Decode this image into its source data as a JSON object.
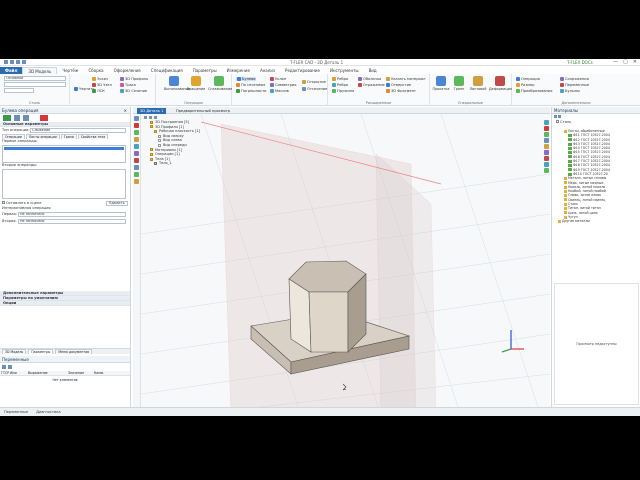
{
  "window": {
    "title": "T-FLEX CAD - 3D Деталь 1",
    "account": "T-FLEX DOCs",
    "minimize": "—",
    "maximize": "▢",
    "close": "✕"
  },
  "menu": [
    "Файл",
    "3D Модель",
    "Чертёж",
    "Сборка",
    "Оформление",
    "Спецификация",
    "Параметры",
    "Измерение",
    "Анализ",
    "Редактирование",
    "Инструменты",
    "Вид"
  ],
  "ribbon": {
    "document": {
      "combo1": "Основной",
      "combo2": "",
      "label": "Стиль"
    },
    "sketch": {
      "items": [
        "Чертить",
        "Эскиз",
        "3D Узел",
        "ЛСК",
        "3D Профиль",
        "Траса",
        "3D Сечение"
      ],
      "label": ""
    },
    "operations": {
      "items": [
        "Выталкивание",
        "Вращение",
        "Сглаживание"
      ],
      "label": "Операции"
    },
    "booleans": {
      "items": [
        "Булева",
        "По сечениям",
        "Погрешности",
        "Уклон",
        "Симметрия",
        "Массив",
        "Открытие",
        "Отсечение"
      ],
      "label": ""
    },
    "extended": {
      "items": [
        "Ребра",
        "Ребро",
        "Пружина",
        "Оболочка",
        "Отражение",
        "Указать материал",
        "Отверстие",
        "3D Фрагмент"
      ],
      "label": "Расширенные"
    },
    "special": {
      "items": [
        "Прокатка",
        "Гранн",
        "Листовой",
        "Деформация"
      ],
      "label": "Специальные"
    },
    "extra": {
      "items": [
        "Операция",
        "Размер",
        "Преобразования",
        "Сопряжения",
        "Переменные",
        "Булыны"
      ],
      "label": "Дополнительно"
    }
  },
  "left_panel": {
    "title": "Булева операция",
    "sections": {
      "main_params": "Основные параметры",
      "extra_params": "Дополнительные параметры",
      "default_params": "Параметры по умолчанию",
      "options": "Опции"
    },
    "op_type_label": "Тип операции:",
    "op_type_value": "Сложение",
    "subtabs": [
      "Операции",
      "Листы операции",
      "Грани",
      "Свойства тела"
    ],
    "first_ops_label": "Первые операнды:",
    "second_ops_label": "Вторые операнды:",
    "leave_checkbox": "Оставлять в сцене",
    "delete_btn": "Удалить",
    "intersect_label": "Интерактивная операция",
    "first_label": "Первая:",
    "first_value": "Не назначено",
    "second_label": "Вторая:",
    "second_value": "Не назначено",
    "bottom_tabs": [
      "3D Модель",
      "Параметры",
      "Меню документов"
    ],
    "vars": {
      "title": "Переменные",
      "columns": [
        "ГТСР",
        "Имя",
        "Выражение",
        "Значение",
        "Комм."
      ],
      "empty": "Нет элементов"
    }
  },
  "doc_tabs": [
    "3D Деталь 1",
    "Предварительный просмотр"
  ],
  "model_tree": {
    "nodes": [
      "3D Построения [5]",
      "3D Профили [1]",
      "Рабочая плоскость [1]",
      "Вид сверху",
      "Вид слева",
      "Вид спереди",
      "Материалы [1]",
      "Операции [1]",
      "Тела [1]",
      "Тело_1"
    ]
  },
  "right_panel": {
    "title": "Материалы",
    "filter": "Сталь",
    "items": [
      "Листы, обработанные",
      "Ф11 ГОСТ 10527-2004",
      "Ф12 ГОСТ 10527-2004",
      "Ф13 ГОСТ 10527-2004",
      "Ф14 ГОСТ 10527-2004",
      "Ф15 ГОСТ 10527-2004",
      "Ф16 ГОСТ 10527-2004",
      "Ф17 ГОСТ 10527-2004",
      "Ф18 ГОСТ 10527-2004",
      "Ф19 ГОСТ 10527-2004",
      "Ф110 ГОСТ 10527-20",
      "Металл, литые сплавы",
      "Медь, литые медные",
      "Никель, литой никель",
      "Ниобий, литой ниобий",
      "Олово, литое олово",
      "Свинец, литой свинец",
      "Сталь",
      "Титан, литой титан",
      "Цинк, литой цинк",
      "Чугун",
      "Другие металлы"
    ],
    "preview_label": "Просмотр недоступны"
  },
  "status": {
    "items": [
      "Переменные",
      "Диагностика"
    ]
  },
  "colors": {
    "accent": "#2b6cb0",
    "box_face_top": "#c9c0b3",
    "box_face_front": "#ded6c9",
    "box_face_side": "#a89d8e",
    "plane": "#ddc9c9"
  }
}
